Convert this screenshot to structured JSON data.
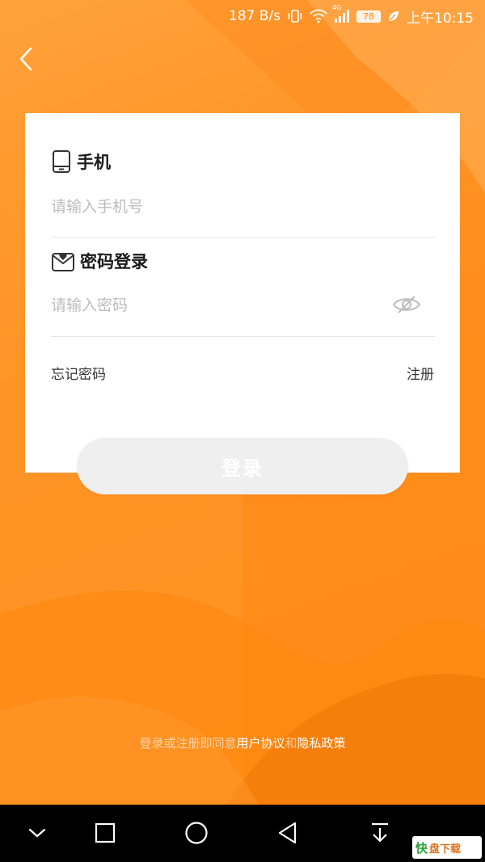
{
  "status_bar": {
    "net_speed": "187 B/s",
    "signal_tag": "4G",
    "battery": "78",
    "time": "上午10:15"
  },
  "form": {
    "phone_label": "手机",
    "phone_placeholder": "请输入手机号",
    "password_label": "密码登录",
    "password_placeholder": "请输入密码",
    "forgot_password": "忘记密码",
    "register": "注册",
    "login_button": "登录"
  },
  "agreement": {
    "prefix": "登录或注册即同意",
    "user_agreement": "用户协议",
    "and": "和",
    "privacy_policy": "隐私政策"
  },
  "watermark": {
    "logo": "快",
    "text": "盘下载"
  },
  "colors": {
    "background": "#FF8A1A",
    "card": "#FFFFFF",
    "button_disabled": "#EFEFEF",
    "nav_bar": "#000000"
  },
  "icons": {
    "back": "chevron-left-icon",
    "phone": "phone-icon",
    "password": "heart-envelope-icon",
    "eye": "eye-off-icon"
  }
}
